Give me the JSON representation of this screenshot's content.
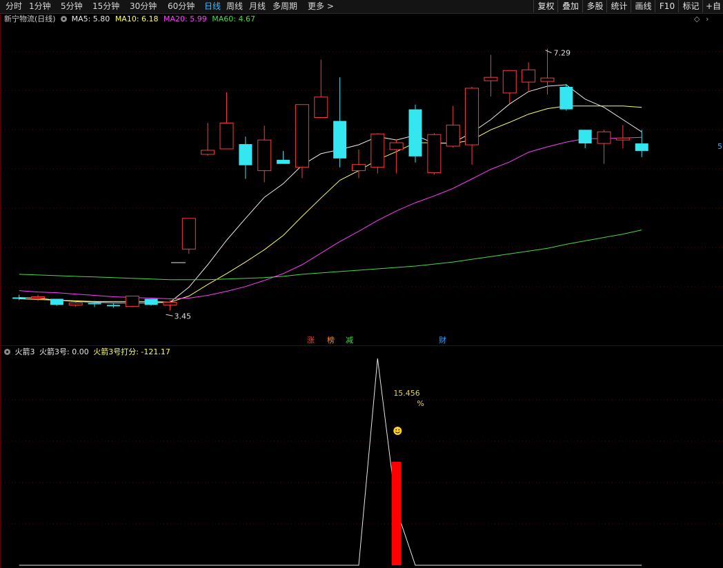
{
  "toolbar": {
    "periods": [
      "分时",
      "1分钟",
      "5分钟",
      "15分钟",
      "30分钟",
      "60分钟",
      "日线",
      "周线",
      "月线",
      "多周期",
      "更多 >"
    ],
    "active_period": "日线",
    "right_buttons": [
      "复权",
      "叠加",
      "多股",
      "统计",
      "画线",
      "F10",
      "标记",
      "+自选"
    ]
  },
  "main_chart": {
    "title": "新宁物流(日线)",
    "ma_legend": [
      {
        "label": "MA5: 5.80",
        "color": "#e8e8e8"
      },
      {
        "label": "MA10: 6.18",
        "color": "#ffff55"
      },
      {
        "label": "MA20: 5.99",
        "color": "#ff3dff"
      },
      {
        "label": "MA60: 4.67",
        "color": "#44dd44"
      }
    ],
    "high_marker": "7.29",
    "low_marker": "3.45",
    "event_badges": [
      {
        "text": "涨",
        "color": "#ff4040"
      },
      {
        "text": "榜",
        "color": "#ff8c1a"
      },
      {
        "text": "减",
        "color": "#44dd44"
      },
      {
        "text": "财",
        "color": "#3aa0ff"
      }
    ],
    "right_edge_label": "5"
  },
  "sub_chart": {
    "title": "火箭3",
    "legend": [
      {
        "label": "火箭3号: 0.00",
        "color": "#e8e8e8"
      },
      {
        "label": "火箭3号打分: -121.17",
        "color": "#ffff55"
      }
    ],
    "percent_value": "15.456",
    "percent_unit": "%"
  },
  "chart_data": [
    {
      "type": "candlestick",
      "title": "新宁物流(日线)",
      "ylim": [
        3.2,
        7.6
      ],
      "candles": [
        {
          "o": 3.64,
          "h": 3.68,
          "l": 3.6,
          "c": 3.62
        },
        {
          "o": 3.63,
          "h": 3.68,
          "l": 3.59,
          "c": 3.65
        },
        {
          "o": 3.62,
          "h": 3.62,
          "l": 3.52,
          "c": 3.53
        },
        {
          "o": 3.53,
          "h": 3.58,
          "l": 3.5,
          "c": 3.56
        },
        {
          "o": 3.56,
          "h": 3.59,
          "l": 3.5,
          "c": 3.54
        },
        {
          "o": 3.53,
          "h": 3.55,
          "l": 3.49,
          "c": 3.51
        },
        {
          "o": 3.51,
          "h": 3.66,
          "l": 3.5,
          "c": 3.66
        },
        {
          "o": 3.62,
          "h": 3.62,
          "l": 3.52,
          "c": 3.53
        },
        {
          "o": 3.53,
          "h": 3.6,
          "l": 3.45,
          "c": 3.57
        },
        {
          "o": 4.35,
          "h": 4.8,
          "l": 4.28,
          "c": 4.8
        },
        {
          "o": 5.74,
          "h": 6.2,
          "l": 5.72,
          "c": 5.8
        },
        {
          "o": 5.82,
          "h": 6.65,
          "l": 5.82,
          "c": 6.2
        },
        {
          "o": 5.89,
          "h": 6.0,
          "l": 5.38,
          "c": 5.58
        },
        {
          "o": 5.5,
          "h": 6.16,
          "l": 5.33,
          "c": 5.95
        },
        {
          "o": 5.66,
          "h": 5.79,
          "l": 5.63,
          "c": 5.6
        },
        {
          "o": 5.55,
          "h": 6.47,
          "l": 5.39,
          "c": 6.47
        },
        {
          "o": 6.28,
          "h": 7.13,
          "l": 6.28,
          "c": 6.58
        },
        {
          "o": 6.23,
          "h": 6.87,
          "l": 5.55,
          "c": 5.68
        },
        {
          "o": 5.5,
          "h": 5.81,
          "l": 5.39,
          "c": 5.59
        },
        {
          "o": 5.55,
          "h": 6.05,
          "l": 5.46,
          "c": 6.04
        },
        {
          "o": 5.81,
          "h": 5.96,
          "l": 5.46,
          "c": 5.91
        },
        {
          "o": 6.4,
          "h": 6.47,
          "l": 5.62,
          "c": 5.71
        },
        {
          "o": 5.47,
          "h": 6.05,
          "l": 5.44,
          "c": 6.03
        },
        {
          "o": 5.86,
          "h": 6.45,
          "l": 5.84,
          "c": 6.17
        },
        {
          "o": 5.88,
          "h": 6.73,
          "l": 5.59,
          "c": 6.71
        },
        {
          "o": 6.82,
          "h": 7.2,
          "l": 6.59,
          "c": 6.87
        },
        {
          "o": 6.64,
          "h": 6.96,
          "l": 6.49,
          "c": 6.97
        },
        {
          "o": 6.8,
          "h": 7.09,
          "l": 6.66,
          "c": 6.98
        },
        {
          "o": 6.81,
          "h": 7.29,
          "l": 6.62,
          "c": 6.86
        },
        {
          "o": 6.73,
          "h": 6.77,
          "l": 6.38,
          "c": 6.4
        },
        {
          "o": 6.1,
          "h": 6.1,
          "l": 5.83,
          "c": 5.9
        },
        {
          "o": 5.9,
          "h": 6.1,
          "l": 5.6,
          "c": 6.07
        },
        {
          "o": 5.95,
          "h": 6.17,
          "l": 5.83,
          "c": 5.98
        },
        {
          "o": 5.9,
          "h": 6.1,
          "l": 5.7,
          "c": 5.79
        }
      ],
      "series": [
        {
          "name": "MA5",
          "color": "#e8e8e8",
          "values": [
            3.64,
            3.63,
            3.6,
            3.58,
            3.57,
            3.56,
            3.56,
            3.56,
            3.57,
            3.79,
            4.12,
            4.48,
            4.8,
            5.11,
            5.31,
            5.58,
            5.75,
            5.81,
            5.88,
            6.0,
            5.95,
            6.02,
            5.9,
            5.91,
            6.06,
            6.25,
            6.48,
            6.66,
            6.74,
            6.76,
            6.55,
            6.43,
            6.25,
            6.07
          ]
        },
        {
          "name": "MA10",
          "color": "#ffff55",
          "values": [
            3.62,
            3.61,
            3.6,
            3.59,
            3.58,
            3.58,
            3.58,
            3.58,
            3.57,
            3.66,
            3.83,
            3.99,
            4.16,
            4.34,
            4.55,
            4.83,
            5.1,
            5.36,
            5.5,
            5.66,
            5.78,
            5.91,
            5.91,
            5.9,
            5.95,
            6.1,
            6.21,
            6.33,
            6.41,
            6.45,
            6.45,
            6.45,
            6.45,
            6.43
          ]
        },
        {
          "name": "MA20",
          "color": "#ff3dff",
          "values": [
            3.74,
            3.72,
            3.71,
            3.69,
            3.67,
            3.65,
            3.64,
            3.63,
            3.62,
            3.63,
            3.67,
            3.73,
            3.8,
            3.89,
            3.99,
            4.12,
            4.29,
            4.46,
            4.61,
            4.77,
            4.91,
            5.03,
            5.13,
            5.24,
            5.38,
            5.52,
            5.63,
            5.77,
            5.85,
            5.92,
            5.97,
            5.97,
            5.98,
            5.99
          ]
        },
        {
          "name": "MA60",
          "color": "#44dd44",
          "values": [
            3.98,
            3.97,
            3.96,
            3.95,
            3.94,
            3.93,
            3.92,
            3.91,
            3.9,
            3.9,
            3.9,
            3.91,
            3.92,
            3.93,
            3.95,
            3.98,
            4.0,
            4.02,
            4.04,
            4.06,
            4.08,
            4.1,
            4.13,
            4.16,
            4.2,
            4.24,
            4.28,
            4.32,
            4.36,
            4.42,
            4.47,
            4.52,
            4.57,
            4.63
          ]
        }
      ],
      "annotations": [
        "7.29",
        "3.45"
      ]
    },
    {
      "type": "line",
      "title": "火箭3",
      "ylim": [
        0,
        100
      ],
      "series": [
        {
          "name": "火箭3号",
          "color": "#e8e8e8",
          "values": [
            0,
            0,
            0,
            0,
            0,
            0,
            0,
            0,
            0,
            0,
            0,
            0,
            0,
            0,
            0,
            0,
            0,
            0,
            0,
            100,
            27,
            0,
            0,
            0,
            0,
            0,
            0,
            0,
            0,
            0,
            0,
            0,
            0,
            0
          ]
        },
        {
          "name": "火箭3号打分",
          "color": "#ff0000",
          "values": [
            0,
            0,
            0,
            0,
            0,
            0,
            0,
            0,
            0,
            0,
            0,
            0,
            0,
            0,
            0,
            0,
            0,
            0,
            0,
            0,
            50,
            0,
            0,
            0,
            0,
            0,
            0,
            0,
            0,
            0,
            0,
            0,
            0,
            0
          ]
        }
      ],
      "annotations": [
        "15.456%"
      ]
    }
  ]
}
